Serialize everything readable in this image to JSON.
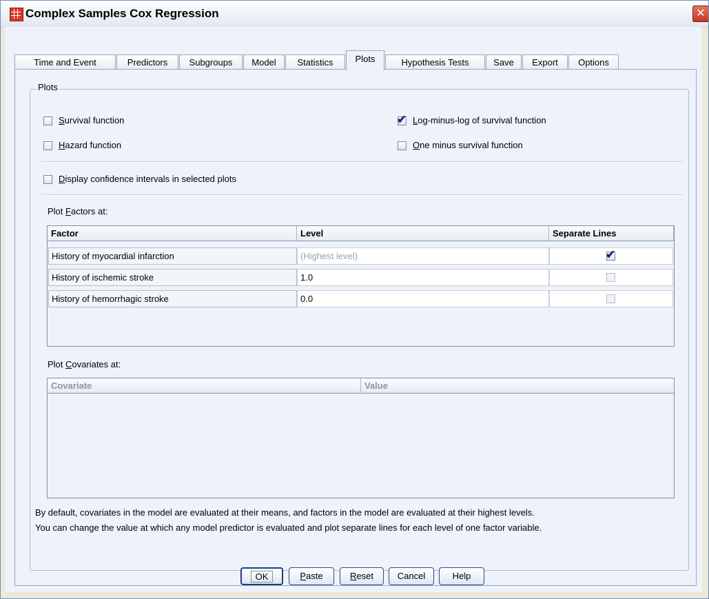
{
  "window": {
    "title": "Complex Samples Cox Regression"
  },
  "tabs": [
    {
      "label": "Time and Event",
      "active": false
    },
    {
      "label": "Predictors",
      "active": false
    },
    {
      "label": "Subgroups",
      "active": false
    },
    {
      "label": "Model",
      "active": false
    },
    {
      "label": "Statistics",
      "active": false
    },
    {
      "label": "Plots",
      "active": true
    },
    {
      "label": "Hypothesis Tests",
      "active": false
    },
    {
      "label": "Save",
      "active": false
    },
    {
      "label": "Export",
      "active": false
    },
    {
      "label": "Options",
      "active": false
    }
  ],
  "plots": {
    "group_label": "Plots",
    "survival": {
      "label": "Survival function",
      "mnemonic": "S",
      "rest": "urvival function",
      "checked": false
    },
    "hazard": {
      "label": "Hazard function",
      "mnemonic": "H",
      "rest": "azard function",
      "checked": false
    },
    "lml": {
      "label": "Log-minus-log of survival function",
      "mnemonic": "L",
      "rest": "og-minus-log of survival function",
      "checked": true
    },
    "oneminus": {
      "label": "One minus survival function",
      "mnemonic": "O",
      "rest": "ne minus survival function",
      "checked": false
    },
    "ci": {
      "label": "Display confidence intervals in selected plots",
      "mnemonic": "D",
      "rest": "isplay confidence intervals in selected plots",
      "checked": false
    }
  },
  "factors": {
    "label": "Plot Factors at:",
    "label_pre": "Plot ",
    "label_mn": "F",
    "label_post": "actors at:",
    "headers": {
      "factor": "Factor",
      "level": "Level",
      "separate": "Separate Lines"
    },
    "rows": [
      {
        "factor": "History of myocardial infarction",
        "level": "(Highest level)",
        "separate": true
      },
      {
        "factor": "History of ischemic stroke",
        "level": "1.0",
        "separate": false
      },
      {
        "factor": "History of hemorrhagic stroke",
        "level": "0.0",
        "separate": false
      }
    ]
  },
  "covariates": {
    "label": "Plot Covariates at:",
    "label_pre": "Plot ",
    "label_mn": "C",
    "label_post": "ovariates at:",
    "headers": {
      "covariate": "Covariate",
      "value": "Value"
    }
  },
  "note": {
    "line1": "By default, covariates in the model are evaluated at their means, and factors in the model are evaluated at their highest levels.",
    "line2": "You can change the value at which any model predictor is evaluated and plot separate lines for each level of one factor variable."
  },
  "buttons": {
    "ok": "OK",
    "paste": "Paste",
    "paste_mn": "P",
    "paste_rest": "aste",
    "reset": "Reset",
    "reset_mn": "R",
    "reset_rest": "eset",
    "cancel": "Cancel",
    "help": "Help"
  },
  "colors": {
    "check": "#1f2a8a",
    "close_button": "#c23a22",
    "panel_bg": "#edf2fb"
  }
}
